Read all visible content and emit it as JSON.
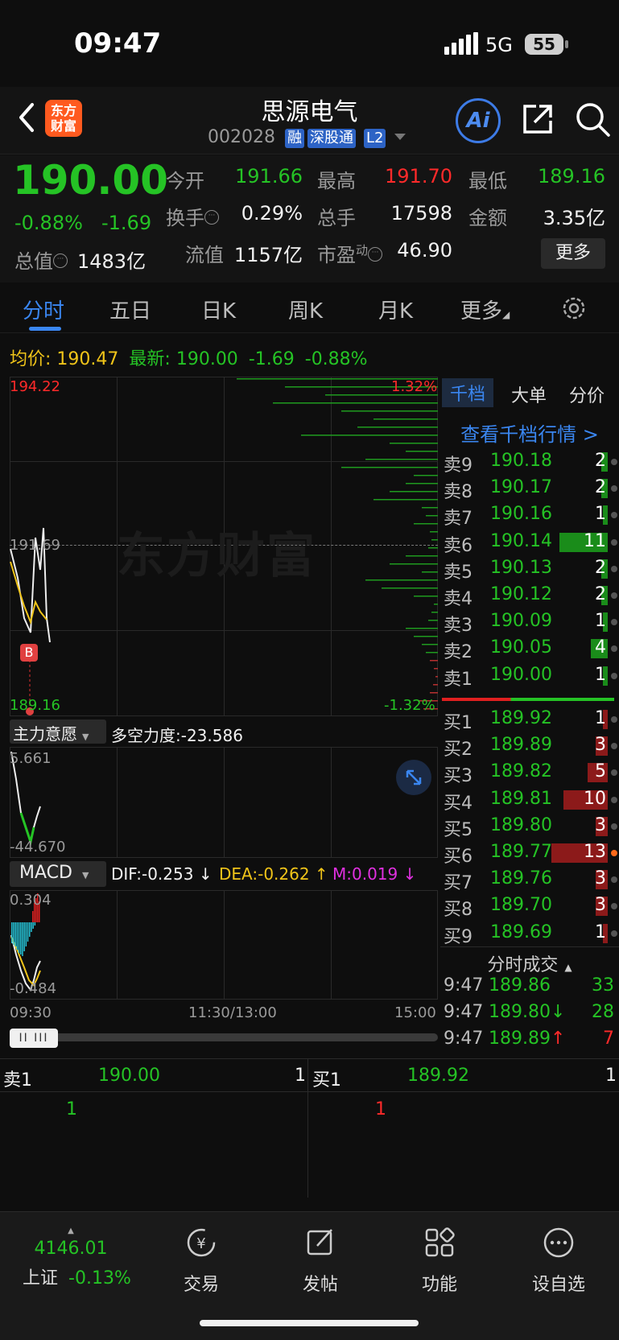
{
  "status_bar": {
    "time": "09:47",
    "network": "5G",
    "battery": "55"
  },
  "header": {
    "logo_line1": "东方",
    "logo_line2": "财富",
    "name": "思源电气",
    "code": "002028",
    "tags": [
      "融",
      "深股通",
      "L2"
    ],
    "ai_label": "Ai"
  },
  "quote": {
    "price": "190.00",
    "change_pct": "-0.88%",
    "change_abs": "-1.69",
    "total_value_label": "总值",
    "total_value": "1483亿",
    "open_label": "今开",
    "open": "191.66",
    "high_label": "最高",
    "high": "191.70",
    "low_label": "最低",
    "low": "189.16",
    "turnover_label": "换手",
    "turnover": "0.29%",
    "volume_label": "总手",
    "volume": "17598",
    "amount_label": "金额",
    "amount": "3.35亿",
    "float_label": "流值",
    "float_value": "1157亿",
    "pe_label": "市盈",
    "pe_sup": "动",
    "pe": "46.90",
    "more": "更多"
  },
  "tabs": [
    "分时",
    "五日",
    "日K",
    "周K",
    "月K",
    "更多"
  ],
  "price_line": {
    "avg_label": "均价:",
    "avg": "190.47",
    "latest_label": "最新:",
    "latest": "190.00",
    "chg": "-1.69",
    "pct": "-0.88%"
  },
  "main_chart": {
    "y_top": "194.22",
    "pct_top": "1.32%",
    "y_mid": "191.69",
    "y_bottom": "189.16",
    "pct_bottom": "-1.32%",
    "marker": "B",
    "watermark": "东方财富"
  },
  "indicator1": {
    "selector": "主力意愿",
    "text": "多空力度:-23.586",
    "y_top": "5.661",
    "y_bottom": "-44.670"
  },
  "macd": {
    "selector": "MACD",
    "dif": "DIF:-0.253 ↓",
    "dea": "DEA:-0.262 ↑",
    "m": "M:0.019 ↓",
    "y_top": "0.304",
    "y_bottom": "-0.484"
  },
  "time_axis": [
    "09:30",
    "11:30/13:00",
    "15:00"
  ],
  "order_book": {
    "tabs": [
      "千档",
      "大单",
      "分价"
    ],
    "link": "查看千档行情 >",
    "asks": [
      {
        "label": "卖9",
        "price": "190.18",
        "vol": "2",
        "bar": 0.12
      },
      {
        "label": "卖8",
        "price": "190.17",
        "vol": "2",
        "bar": 0.12
      },
      {
        "label": "卖7",
        "price": "190.16",
        "vol": "1",
        "bar": 0.06
      },
      {
        "label": "卖6",
        "price": "190.14",
        "vol": "11",
        "bar": 0.85
      },
      {
        "label": "卖5",
        "price": "190.13",
        "vol": "2",
        "bar": 0.12
      },
      {
        "label": "卖4",
        "price": "190.12",
        "vol": "2",
        "bar": 0.12
      },
      {
        "label": "卖3",
        "price": "190.09",
        "vol": "1",
        "bar": 0.06
      },
      {
        "label": "卖2",
        "price": "190.05",
        "vol": "4",
        "bar": 0.3
      },
      {
        "label": "卖1",
        "price": "190.00",
        "vol": "1",
        "bar": 0.06
      }
    ],
    "bids": [
      {
        "label": "买1",
        "price": "189.92",
        "vol": "1",
        "bar": 0.06
      },
      {
        "label": "买2",
        "price": "189.89",
        "vol": "3",
        "bar": 0.22
      },
      {
        "label": "买3",
        "price": "189.82",
        "vol": "5",
        "bar": 0.35
      },
      {
        "label": "买4",
        "price": "189.81",
        "vol": "10",
        "bar": 0.78
      },
      {
        "label": "买5",
        "price": "189.80",
        "vol": "3",
        "bar": 0.22
      },
      {
        "label": "买6",
        "price": "189.77",
        "vol": "13",
        "bar": 1.0
      },
      {
        "label": "买7",
        "price": "189.76",
        "vol": "3",
        "bar": 0.22
      },
      {
        "label": "买8",
        "price": "189.70",
        "vol": "3",
        "bar": 0.22
      },
      {
        "label": "买9",
        "price": "189.69",
        "vol": "1",
        "bar": 0.06
      }
    ]
  },
  "trades": {
    "title": "分时成交",
    "rows": [
      {
        "time": "9:47",
        "price": "189.86",
        "arrow": "",
        "vol": "33",
        "color": "#25c325"
      },
      {
        "time": "9:47",
        "price": "189.80",
        "arrow": "↓",
        "vol": "28",
        "color": "#25c325"
      },
      {
        "time": "9:47",
        "price": "189.89",
        "arrow": "↑",
        "vol": "7",
        "color": "#ff2a2a"
      }
    ]
  },
  "bid_ask_panel": {
    "ask_label": "卖1",
    "ask_price": "190.00",
    "ask_vol": "1",
    "ask_detail": "1",
    "bid_label": "买1",
    "bid_price": "189.92",
    "bid_vol": "1",
    "bid_detail": "1"
  },
  "bottom_nav": {
    "index_value": "4146.01",
    "index_name": "上证",
    "index_chg": "-0.13%",
    "items": [
      "交易",
      "发帖",
      "功能",
      "设自选"
    ]
  },
  "colors": {
    "up": "#ff2a2a",
    "down": "#25c325",
    "accent": "#3a86f0",
    "avg_line": "#f0c419"
  }
}
